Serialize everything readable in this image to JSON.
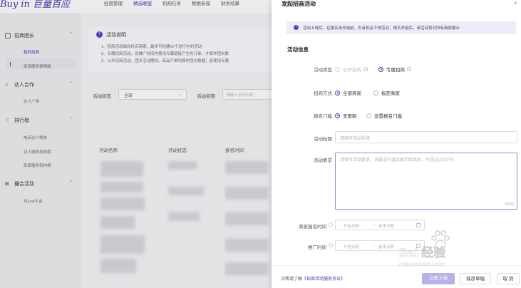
{
  "brand": {
    "logo": "Buy in 巨量百应"
  },
  "topnav": [
    "经营管理",
    "精选联盟",
    "机构任务",
    "数据参谋",
    "财务结算"
  ],
  "sidebar": {
    "groups": [
      {
        "label": "招商团长",
        "items": [
          "我的招商",
          "招商服务费明细"
        ]
      },
      {
        "label": "达人合作",
        "items": [
          "达人广场"
        ]
      },
      {
        "label": "排行榜",
        "items": [
          "电商达人榜单",
          "达人服务机构榜",
          "商家服务机构榜"
        ]
      },
      {
        "label": "撮合活动",
        "items": [
          "抖Link大会"
        ]
      }
    ]
  },
  "notice": {
    "title": "活动说明",
    "lines": [
      "1、招商活动面向抖店商家，最多可创建50个进行中的活动",
      "2、专属招商活动，仅推广时间内使用专属链接产生的订单，才算作团长数",
      "3、公开招商活动，团长活动期间，商品产单均算作团长数据；若使用专属"
    ]
  },
  "filters": {
    "status_label": "活动状态",
    "status_value": "全部",
    "name_label": "活动名称",
    "name_placeholder": "请输入活动名称"
  },
  "table": {
    "headers": [
      "活动名称",
      "活动状态",
      "报名时间"
    ]
  },
  "drawer": {
    "title": "发起招商活动",
    "close": "×",
    "info": "活动上线后，在报名未开始前，仍有机会下线活动；报名开始后，该活动将对所有商家展示",
    "section": "活动信息",
    "activity_type": {
      "label": "活动类型",
      "options": [
        "公开招商",
        "专属招商"
      ],
      "selected": "专属招商"
    },
    "invite_mode": {
      "label": "招商方式",
      "options": [
        "全部商家",
        "指定商家"
      ],
      "selected": "全部商家"
    },
    "threshold": {
      "label": "报名门槛",
      "options": [
        "无限制",
        "设置报名门槛"
      ],
      "selected": "无限制"
    },
    "title_field": {
      "label": "活动标题",
      "placeholder": "请填写活动标题"
    },
    "requirement": {
      "label": "活动要求",
      "placeholder": "请填写活动要求，该要求内容会展示给商家，不超过200字符",
      "counter": "0/200"
    },
    "merchant_time": {
      "label": "商家报名时间",
      "start": "开始日期",
      "sep": "~",
      "end": "结束日期"
    },
    "promo_time": {
      "label": "推广时间",
      "start": "开始日期",
      "sep": "~",
      "end": "结束日期"
    },
    "footer": {
      "text_prefix": "详情请了解",
      "link": "《招商活动服务协议》",
      "publish": "立即上线",
      "save": "保存草稿",
      "cancel": "取 消"
    }
  },
  "watermark": {
    "text": "Bai 经验",
    "sub": "jingyan.baidu.com"
  },
  "colors": {
    "accent": "#3f3aa8",
    "primary_disabled": "#b6b3e8",
    "info_bg": "#ededfa"
  }
}
